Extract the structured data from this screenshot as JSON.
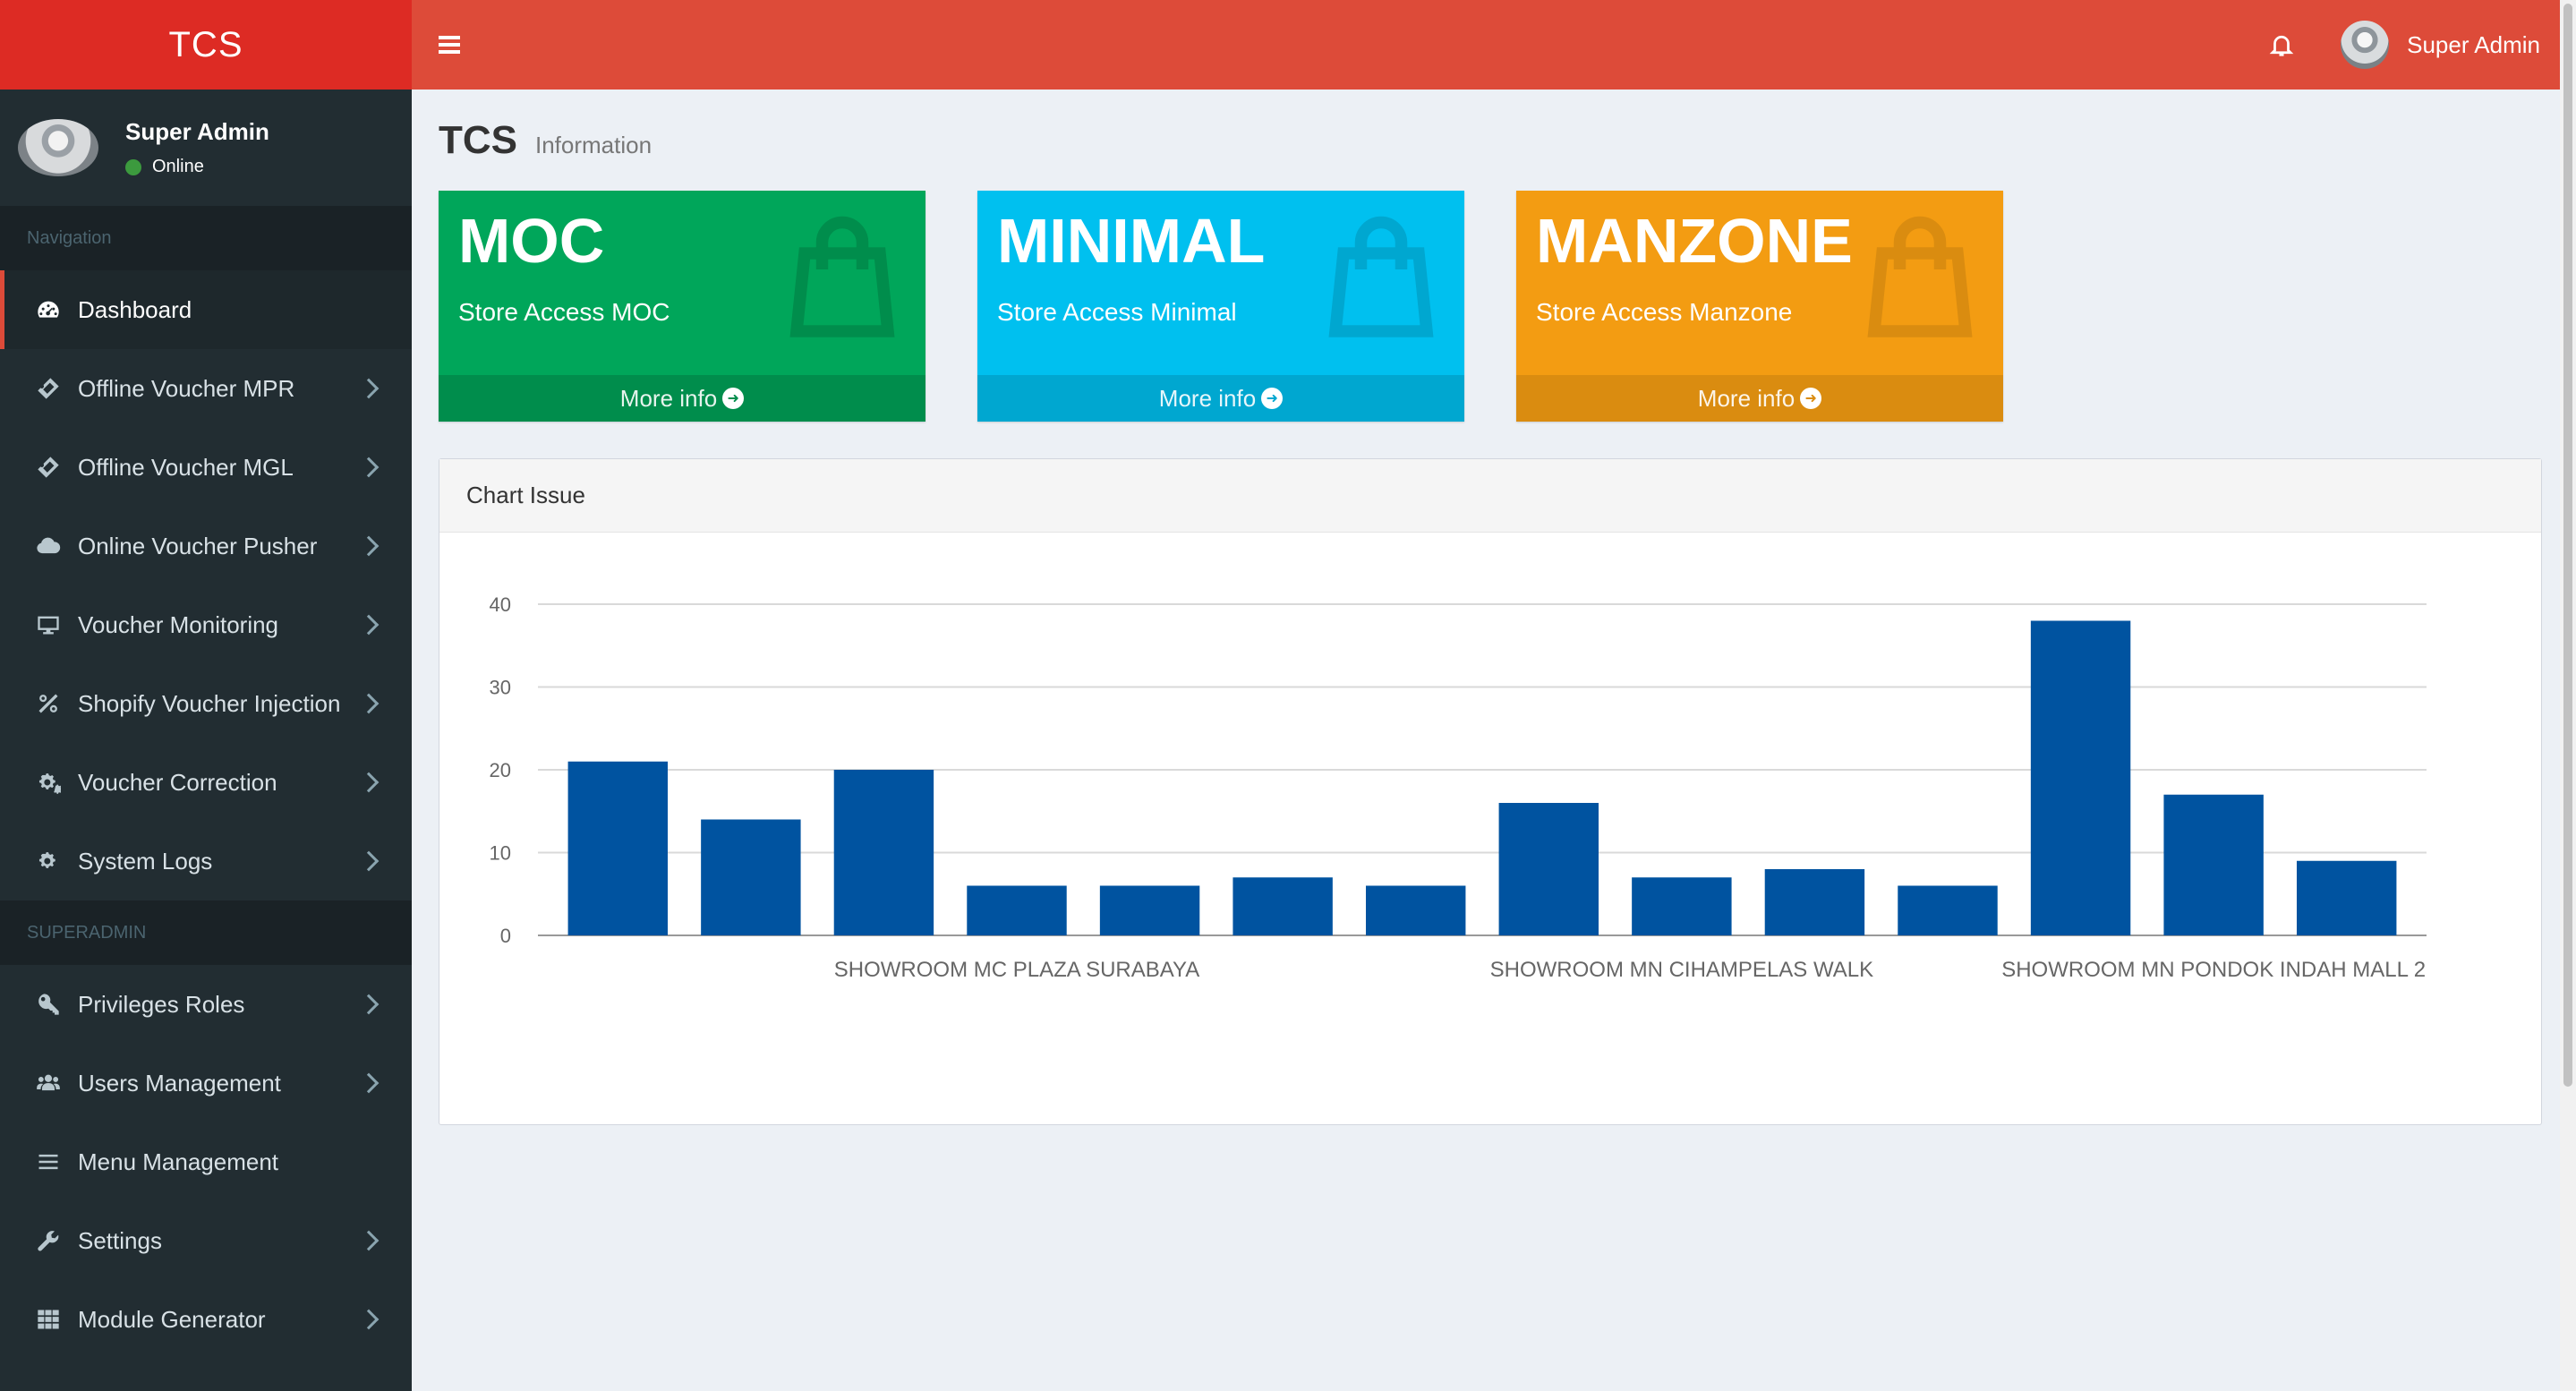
{
  "app": {
    "logo": "TCS"
  },
  "sidebar": {
    "user": {
      "name": "Super Admin",
      "status": "Online"
    },
    "sections": [
      {
        "header": "Navigation"
      },
      {
        "header": "SUPERADMIN"
      }
    ],
    "items": [
      {
        "label": "Dashboard",
        "icon": "dashboard-icon"
      },
      {
        "label": "Offline Voucher MPR",
        "icon": "ticket-icon"
      },
      {
        "label": "Offline Voucher MGL",
        "icon": "ticket-icon"
      },
      {
        "label": "Online Voucher Pusher",
        "icon": "cloud-icon"
      },
      {
        "label": "Voucher Monitoring",
        "icon": "desktop-icon"
      },
      {
        "label": "Shopify Voucher Injection",
        "icon": "percent-icon"
      },
      {
        "label": "Voucher Correction",
        "icon": "cogs-icon"
      },
      {
        "label": "System Logs",
        "icon": "cogs-icon"
      },
      {
        "label": "Privileges Roles",
        "icon": "key-icon"
      },
      {
        "label": "Users Management",
        "icon": "users-icon"
      },
      {
        "label": "Menu Management",
        "icon": "bars-icon"
      },
      {
        "label": "Settings",
        "icon": "wrench-icon"
      },
      {
        "label": "Module Generator",
        "icon": "grid-icon"
      }
    ]
  },
  "topbar": {
    "user_name": "Super Admin"
  },
  "content": {
    "title": "TCS",
    "subtitle": "Information"
  },
  "boxes": [
    {
      "title": "MOC",
      "text": "Store Access MOC",
      "footer": "More info",
      "color": "#00a65a"
    },
    {
      "title": "MINIMAL",
      "text": "Store Access Minimal",
      "footer": "More info",
      "color": "#00c0ef"
    },
    {
      "title": "MANZONE",
      "text": "Store Access Manzone",
      "footer": "More info",
      "color": "#f39c12"
    }
  ],
  "chart_panel": {
    "title": "Chart Issue"
  },
  "chart_data": {
    "type": "bar",
    "title": "",
    "xlabel": "",
    "ylabel": "",
    "ylim": [
      0,
      40
    ],
    "yticks": [
      0,
      10,
      20,
      30,
      40
    ],
    "bar_color": "#0053a0",
    "grid": true,
    "categories": [
      "",
      "",
      "",
      "SHOWROOM MC PLAZA SURABAYA",
      "",
      "",
      "",
      "",
      "SHOWROOM MN CIHAMPELAS WALK",
      "",
      "",
      "",
      "SHOWROOM MN PONDOK INDAH MALL 2",
      ""
    ],
    "values": [
      21,
      14,
      20,
      6,
      6,
      7,
      6,
      16,
      7,
      8,
      6,
      38,
      17,
      9
    ]
  }
}
